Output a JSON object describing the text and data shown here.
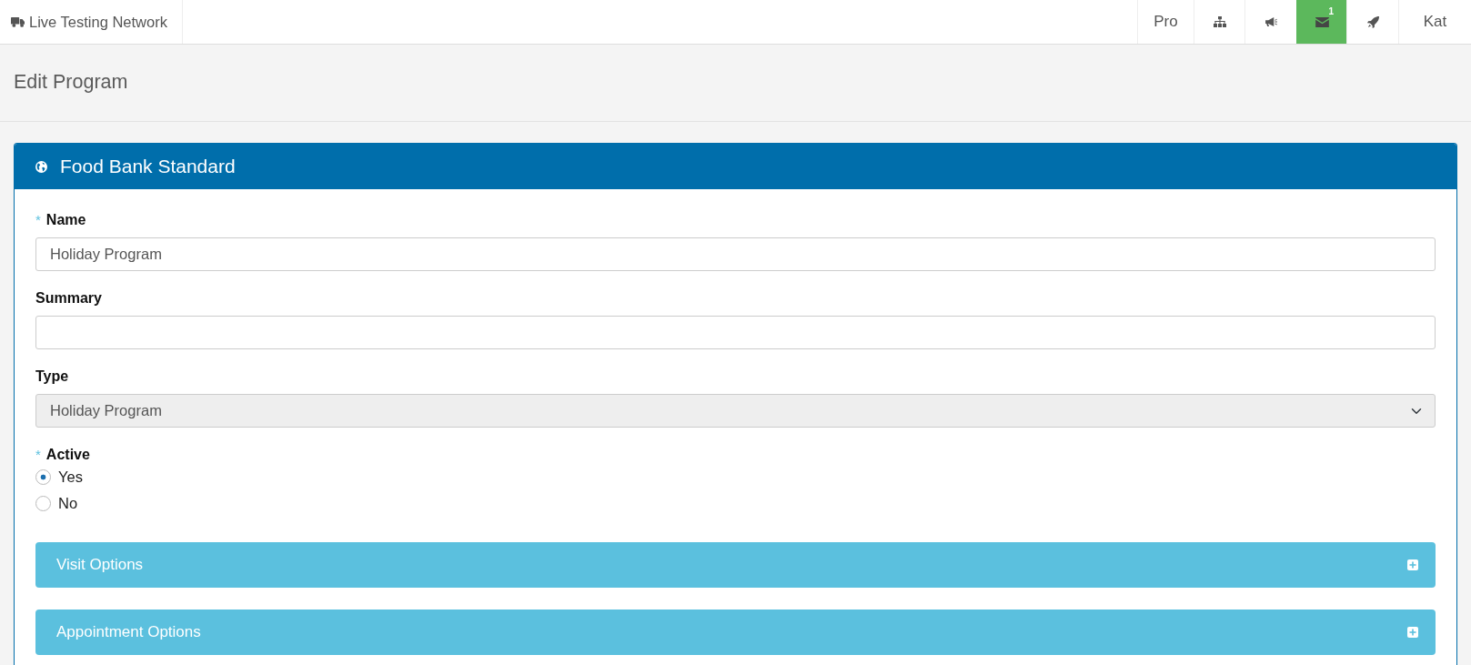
{
  "navbar": {
    "brand": "Live Testing Network",
    "pro_link": "Pro",
    "messages": {
      "count": "1",
      "highlighted": true
    },
    "user": "Kat"
  },
  "page_title": "Edit Program",
  "program": {
    "title": "Food Bank Standard",
    "fields": [
      {
        "kind": "text",
        "label": "Name",
        "required_mark": "*",
        "value": "Holiday Program"
      },
      {
        "kind": "text",
        "label": "Summary"
      },
      {
        "kind": "select",
        "label": "Type",
        "value": "Holiday Program",
        "disabled": true
      },
      {
        "kind": "radio",
        "label": "Active",
        "required_mark": "*",
        "options": [
          {
            "label": "Yes",
            "selected": true
          },
          {
            "label": "No",
            "selected": false
          }
        ]
      }
    ],
    "sections": [
      {
        "title": "Visit Options",
        "expanded": false
      },
      {
        "title": "Appointment Options",
        "expanded": false
      }
    ]
  }
}
